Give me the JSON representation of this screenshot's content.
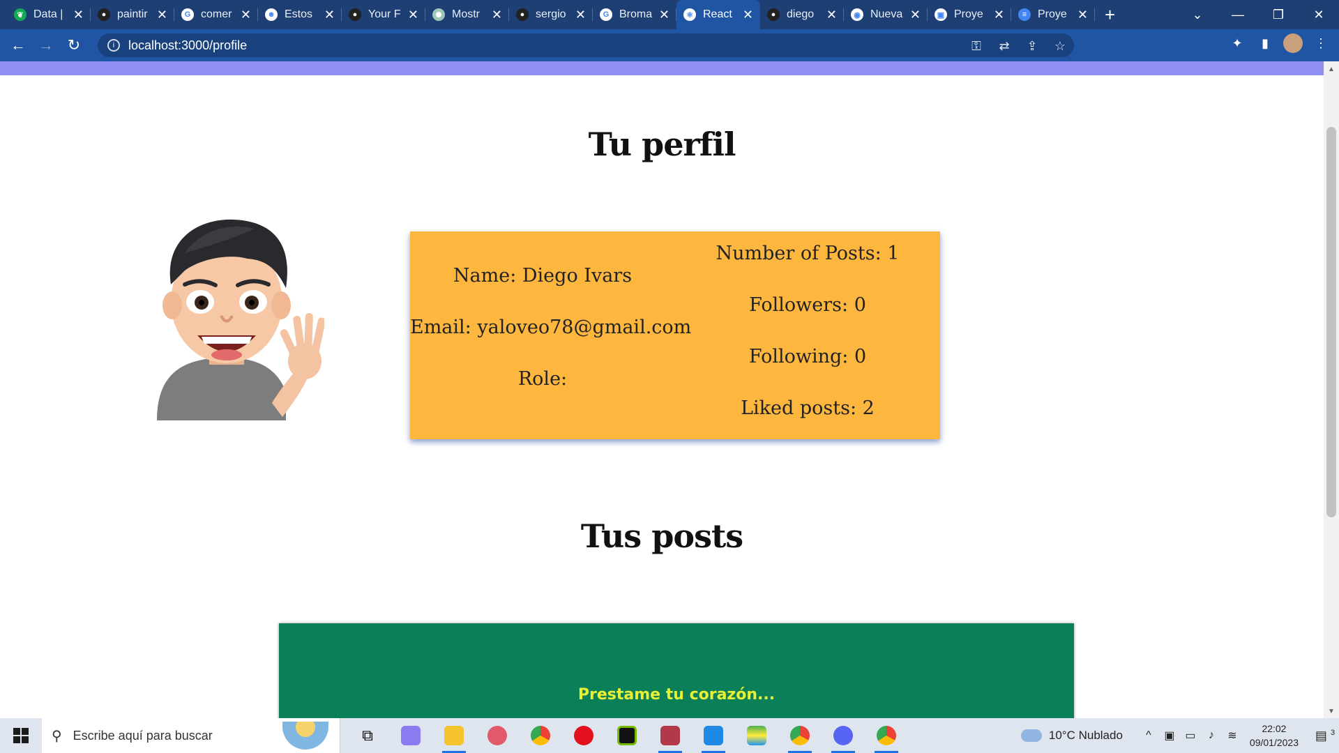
{
  "browser": {
    "tabs": [
      {
        "title": "Data |",
        "icon": "leaf-icon",
        "color": "#13aa52",
        "active": false
      },
      {
        "title": "paintir",
        "icon": "github-icon",
        "color": "#222222",
        "active": false
      },
      {
        "title": "comer",
        "icon": "google-icon",
        "color": "#ffffff",
        "active": false
      },
      {
        "title": "Estos",
        "icon": "mask-icon",
        "color": "#ffffff",
        "active": false
      },
      {
        "title": "Your F",
        "icon": "github-icon",
        "color": "#222222",
        "active": false
      },
      {
        "title": "Mostr",
        "icon": "openai-icon",
        "color": "#9fc6b8",
        "active": false
      },
      {
        "title": "sergio",
        "icon": "github-icon",
        "color": "#222222",
        "active": false
      },
      {
        "title": "Broma",
        "icon": "google-icon",
        "color": "#ffffff",
        "active": false
      },
      {
        "title": "React",
        "icon": "react-icon",
        "color": "#ffffff",
        "active": true
      },
      {
        "title": "diego",
        "icon": "github-icon",
        "color": "#222222",
        "active": false
      },
      {
        "title": "Nueva",
        "icon": "chrome-icon",
        "color": "#ffffff",
        "active": false
      },
      {
        "title": "Proye",
        "icon": "doc-icon",
        "color": "#ffffff",
        "active": false
      },
      {
        "title": "Proye",
        "icon": "docs-icon",
        "color": "#4285f4",
        "active": false
      }
    ],
    "url": "localhost:3000/profile"
  },
  "profile": {
    "title": "Tu perfil",
    "name_line": "Name: Diego Ivars",
    "email_line": "Email: yaloveo78@gmail.com",
    "role_line": "Role:",
    "posts_line": "Number of Posts: 1",
    "followers_line": "Followers: 0",
    "following_line": "Following: 0",
    "liked_line": "Liked posts: 2"
  },
  "posts": {
    "title": "Tus posts",
    "items": [
      {
        "title": "Prestame tu corazón..."
      }
    ]
  },
  "taskbar": {
    "search_placeholder": "Escribe aquí para buscar",
    "weather": "10°C  Nublado",
    "time": "22:02",
    "date": "09/01/2023",
    "notification_count": "3"
  },
  "colors": {
    "tabstrip": "#1e3f73",
    "toolbar": "#1f55a3",
    "purple_bar": "#8f8ef2",
    "info_card": "#fdb63e",
    "post_card": "#0b8058",
    "post_title": "#e9ef33"
  }
}
